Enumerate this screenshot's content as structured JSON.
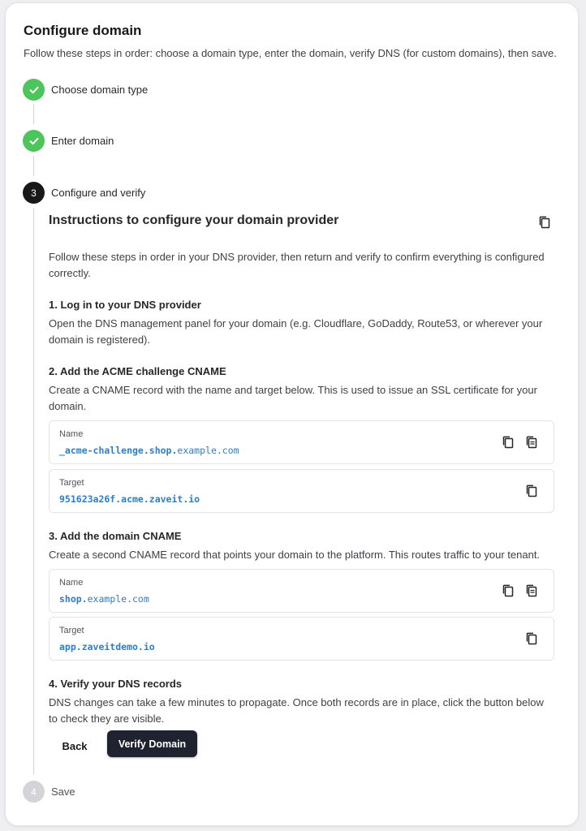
{
  "header": {
    "title": "Configure domain",
    "subtitle": "Follow these steps in order: choose a domain type, enter the domain, verify DNS (for custom domains), then save."
  },
  "steps": [
    {
      "number": "1",
      "label": "Choose domain type",
      "status": "complete"
    },
    {
      "number": "2",
      "label": "Enter domain",
      "status": "complete"
    },
    {
      "number": "3",
      "label": "Configure and verify",
      "status": "active"
    },
    {
      "number": "4",
      "label": "Save",
      "status": "pending"
    }
  ],
  "instructions": {
    "title": "Instructions to configure your domain provider",
    "intro": "Follow these steps in order in your DNS provider, then return and verify to confirm everything is configured correctly.",
    "sections": [
      {
        "heading": "1. Log in to your DNS provider",
        "text": "Open the DNS management panel for your domain (e.g. Cloudflare, GoDaddy, Route53, or wherever your domain is registered)."
      },
      {
        "heading": "2. Add the ACME challenge CNAME",
        "text": "Create a CNAME record with the name and target below. This is used to issue an SSL certificate for your domain.",
        "records": [
          {
            "label": "Name",
            "value_bold": "_acme-challenge.shop.",
            "value_rest": "example.com"
          },
          {
            "label": "Target",
            "value_bold": "951623a26f.acme.zaveit.io",
            "value_rest": ""
          }
        ]
      },
      {
        "heading": "3. Add the domain CNAME",
        "text": "Create a second CNAME record that points your domain to the platform. This routes traffic to your tenant.",
        "records": [
          {
            "label": "Name",
            "value_bold": "shop.",
            "value_rest": "example.com"
          },
          {
            "label": "Target",
            "value_bold": "app.zaveitdemo.io",
            "value_rest": ""
          }
        ]
      },
      {
        "heading": "4. Verify your DNS records",
        "text": "DNS changes can take a few minutes to propagate. Once both records are in place, click the button below to check they are visible."
      }
    ]
  },
  "actions": {
    "back_label": "Back",
    "verify_label": "Verify Domain"
  },
  "colors": {
    "complete": "#4ec45c",
    "active": "#18181b",
    "pending": "#d4d4d8",
    "record_value": "#2b7fc9",
    "primary_button": "#1f2330"
  },
  "icons": {
    "complete": "check-icon",
    "copy": "copy-icon",
    "copy_subdomain": "copy-subdomain-icon"
  }
}
